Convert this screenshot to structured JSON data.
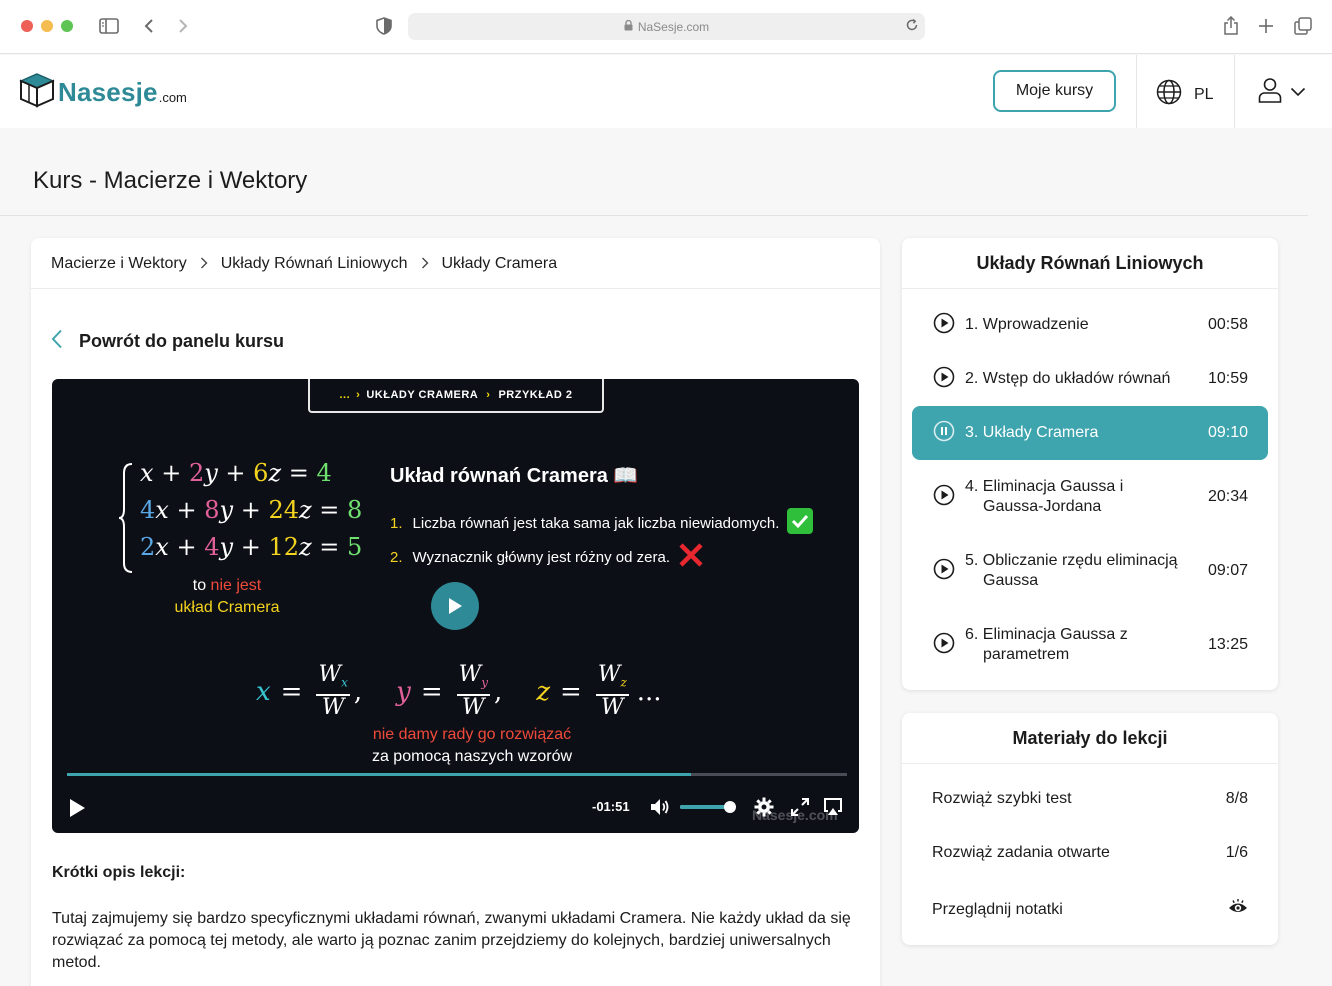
{
  "browser": {
    "url": "NaSesje.com"
  },
  "header": {
    "logo_text": "Nasesje",
    "logo_domain": ".com",
    "my_courses": "Moje kursy",
    "language": "PL"
  },
  "course": {
    "title": "Kurs - Macierze i Wektory"
  },
  "breadcrumb": [
    "Macierze i Wektory",
    "Układy Równań Liniowych",
    "Układy Cramera"
  ],
  "back_link": "Powrót do panelu kursu",
  "video": {
    "crumb": {
      "ellipsis": "...",
      "part1": "UKŁADY CRAMERA",
      "part2": "PRZYKŁAD 2"
    },
    "equations": [
      [
        "x",
        "+",
        "2",
        "y",
        "+",
        "6",
        "z",
        "=",
        "4"
      ],
      [
        "4",
        "x",
        "+",
        "8",
        "y",
        "+",
        "24",
        "z",
        "=",
        "8"
      ],
      [
        "2",
        "x",
        "+",
        "4",
        "y",
        "+",
        "12",
        "z",
        "=",
        "5"
      ]
    ],
    "note_a": {
      "to": "to",
      "nie_jest": "nie jest",
      "uklad": "układ Cramera"
    },
    "title": "Układ równań Cramera",
    "title_emoji": "📖",
    "conditions": [
      {
        "num": "1.",
        "text": "Liczba równań jest taka sama jak liczba niewiadomych."
      },
      {
        "num": "2.",
        "text": "Wyznacznik główny jest różny od zera."
      }
    ],
    "formula": {
      "x": "x",
      "y": "y",
      "z": "z",
      "eq": "=",
      "W": "W",
      "sub_x": "x",
      "sub_y": "y",
      "sub_z": "z",
      "comma": ",",
      "ellipsis": "..."
    },
    "note_b": {
      "line1": "nie damy rady go rozwiązać",
      "line2": "za pomocą naszych wzorów"
    },
    "progress_fraction": 0.8,
    "volume_fraction": 0.9,
    "time_remaining": "-01:51",
    "watermark": "Nasesje.com"
  },
  "description": {
    "heading": "Krótki opis lekcji:",
    "text": "Tutaj zajmujemy się bardzo specyficznymi układami równań, zwanymi układami Cramera. Nie każdy układ da się rozwiązać za pomocą tej metody, ale warto ją poznac zanim przejdziemy do kolejnych, bardziej uniwersalnych metod."
  },
  "lessons_panel": {
    "title": "Układy Równań Liniowych",
    "items": [
      {
        "title": "1. Wprowadzenie",
        "duration": "00:58",
        "state": "play"
      },
      {
        "title": "2. Wstęp do układów równań",
        "duration": "10:59",
        "state": "play"
      },
      {
        "title": "3. Układy Cramera",
        "duration": "09:10",
        "state": "pause"
      },
      {
        "title": "4. Eliminacja Gaussa i Gaussa-Jordana",
        "title_l1": "4. Eliminacja Gaussa i",
        "title_l2": "Gaussa-Jordana",
        "duration": "20:34",
        "state": "play"
      },
      {
        "title": "5. Obliczanie rzędu eliminacją Gaussa",
        "title_l1": "5. Obliczanie rzędu eliminacją",
        "title_l2": "Gaussa",
        "duration": "09:07",
        "state": "play"
      },
      {
        "title": "6. Eliminacja Gaussa z parametrem",
        "title_l1": "6. Eliminacja Gaussa z",
        "title_l2": "parametrem",
        "duration": "13:25",
        "state": "play"
      }
    ]
  },
  "materials_panel": {
    "title": "Materiały do lekcji",
    "items": [
      {
        "label": "Rozwiąż szybki test",
        "value": "8/8"
      },
      {
        "label": "Rozwiąż zadania otwarte",
        "value": "1/6"
      },
      {
        "label": "Przeglądnij notatki",
        "icon": "eye-icon"
      }
    ]
  },
  "colors": {
    "accent": "#3ea4ae",
    "brand": "#2d8a96",
    "video_bg": "#0d0f17"
  }
}
